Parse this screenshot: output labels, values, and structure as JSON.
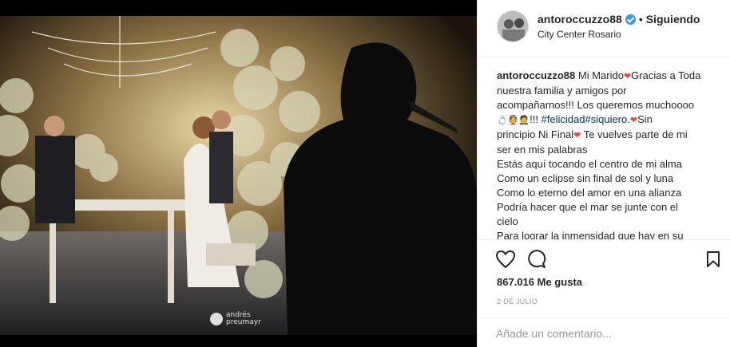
{
  "post": {
    "photo_watermark": "andrés preumayr",
    "username": "antoroccuzzo88",
    "separator": "•",
    "follow_label": "Siguiendo",
    "location": "City Center Rosario"
  },
  "caption": {
    "author": "antoroccuzzo88",
    "line1_text": " Mi Marido",
    "line1_after": "Gracias a Toda",
    "line2": "nuestra familia y amigos por",
    "line3": "acompañarnos!!! Los queremos muchoooo",
    "line4_emojis": "💍👰🤵",
    "line4_text": "!!! ",
    "tag1": "#felicidad",
    "tag2": "#siquiero",
    "line4_end": ".",
    "line4_after": "Sin",
    "line5_text": "principio Ni Final",
    "line5_after": " Te vuelves parte de mi",
    "line6": "ser en mis palabras",
    "line7": "Estás aquí tocando el centro de mi alma",
    "line8": "Como un eclipse sin final de sol y luna",
    "line9": "Como lo eterno del amor en una alianza",
    "line10": "Podría hacer que el mar se junte con el",
    "line11": "cielo",
    "line12": "Para lograr la inmensidad que hay en su",
    "heart": "❤"
  },
  "actions": {
    "likes": "867.016 Me gusta",
    "date": "2 DE JULIO",
    "icons": [
      "heart-icon",
      "comment-icon",
      "bookmark-icon"
    ]
  },
  "comment": {
    "placeholder": "Añade un comentario..."
  },
  "colors": {
    "verified": "#3897f0",
    "heart": "#e8434b",
    "hashtag": "#003569"
  }
}
